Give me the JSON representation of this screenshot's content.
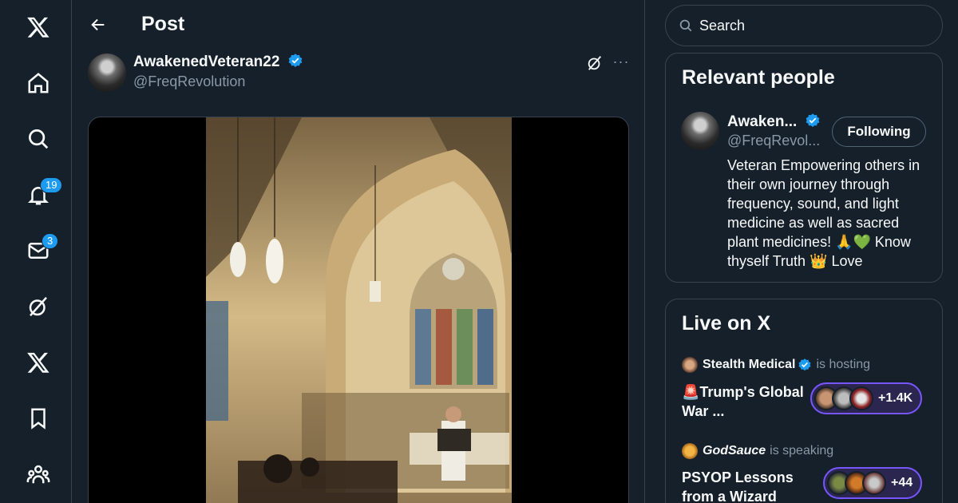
{
  "nav": {
    "notifications_badge": "19",
    "messages_badge": "3"
  },
  "header": {
    "title": "Post"
  },
  "post": {
    "author_name": "AwakenedVeteran22",
    "author_handle": "@FreqRevolution"
  },
  "search": {
    "placeholder": "Search"
  },
  "relevant_people": {
    "title": "Relevant people",
    "name": "Awaken...",
    "handle": "@FreqRevol...",
    "follow_label": "Following",
    "bio": "Veteran Empowering others in their own journey through frequency, sound, and light medicine as well as sacred plant medicines! 🙏💚 Know thyself Truth 👑 Love"
  },
  "live": {
    "title": "Live on X",
    "spaces": [
      {
        "host": "Stealth Medical",
        "status": "is hosting",
        "title": "🚨Trump's Global War ...",
        "count": "+1.4K"
      },
      {
        "host": "GodSauce",
        "status": "is speaking",
        "title": "PSYOP Lessons from a Wizard",
        "count": "+44"
      }
    ]
  },
  "colors": {
    "background": "#15202b",
    "accent": "#1d9bf0",
    "border": "#38444d",
    "muted_text": "#8b98a5",
    "space_ring": "#7856ff"
  }
}
